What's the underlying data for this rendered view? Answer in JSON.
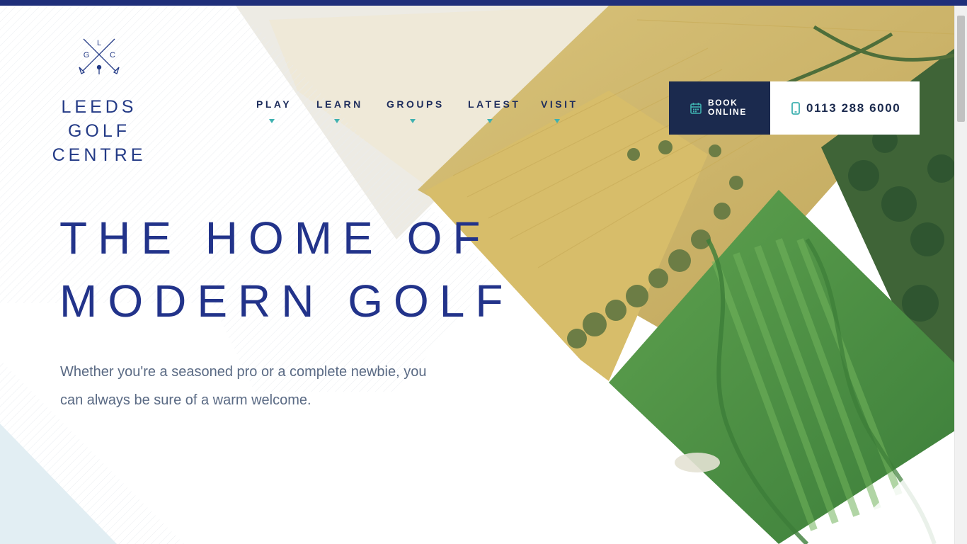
{
  "logo": {
    "monogram": {
      "top": "L",
      "left": "G",
      "right": "C"
    },
    "line1": "LEEDS GOLF",
    "line2": "CENTRE",
    "icon": "crossed-golf-clubs-icon"
  },
  "nav": {
    "items": [
      {
        "label": "PLAY"
      },
      {
        "label": "LEARN"
      },
      {
        "label": "GROUPS"
      },
      {
        "label": "LATEST"
      },
      {
        "label": "VISIT"
      }
    ],
    "caret_icon": "caret-down-icon",
    "caret_color": "#3fb1b0"
  },
  "cta": {
    "book_line1": "BOOK",
    "book_line2": "ONLINE",
    "book_icon": "calendar-icon",
    "phone_number": "0113 288 6000",
    "phone_icon": "mobile-phone-icon"
  },
  "hero": {
    "headline_line1": "THE HOME OF",
    "headline_line2": "MODERN GOLF",
    "subtext": "Whether you're a seasoned pro or a complete newbie, you can always be sure of a warm welcome.",
    "image": "aerial-golf-course-photo"
  },
  "colors": {
    "navy": "#22338a",
    "dark_navy": "#1b2a4e",
    "teal": "#3fb1b0",
    "top_bar": "#1f2f7a"
  }
}
